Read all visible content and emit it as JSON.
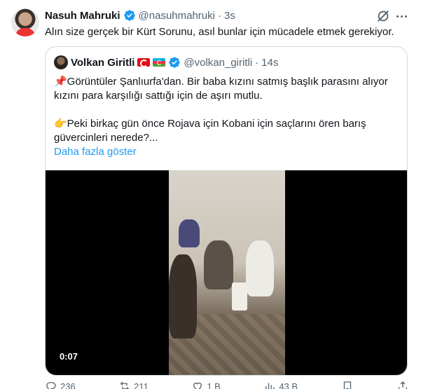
{
  "tweet": {
    "author_name": "Nasuh Mahruki",
    "author_handle": "@nasuhmahruki",
    "separator": "·",
    "time": "3s",
    "text": "Alın size gerçek bir Kürt Sorunu, asıl bunlar için mücadele etmek gerekiyor."
  },
  "quote": {
    "author_name": "Volkan Giritli",
    "author_handle": "@volkan_giritli",
    "separator": "·",
    "time": "14s",
    "line1": "📌Görüntüler Şanlıurfa'dan. Bir baba kızını satmış başlık parasını alıyor kızını para karşılığı sattığı için de aşırı mutlu.",
    "line2": "👉Peki birkaç gün önce Rojava için Kobani için saçlarını ören barış güvercinleri nerede?...",
    "show_more": "Daha fazla göster",
    "video_time": "0:07"
  },
  "actions": {
    "reply_count": "236",
    "retweet_count": "211",
    "like_count": "1 B",
    "views_count": "43 B"
  },
  "icons": {
    "verified": "verified-badge-icon",
    "grok": "grok-icon",
    "more": "more-icon"
  },
  "colors": {
    "accent": "#1d9bf0",
    "secondary_text": "#536471",
    "border": "#cfd9de"
  }
}
